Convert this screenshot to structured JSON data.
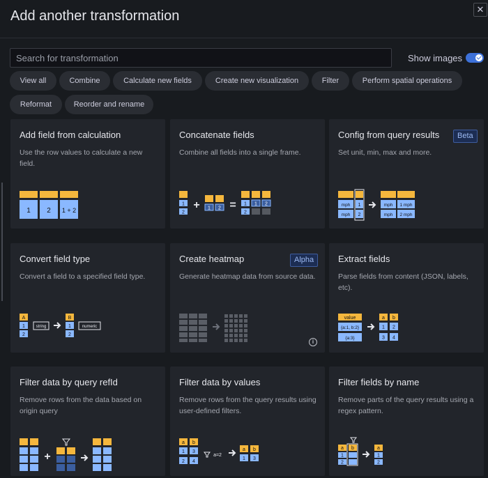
{
  "header": {
    "title": "Add another transformation",
    "close_icon": "close-icon"
  },
  "search": {
    "placeholder": "Search for transformation",
    "value": ""
  },
  "show_images": {
    "label": "Show images",
    "enabled": true
  },
  "filters": [
    "View all",
    "Combine",
    "Calculate new fields",
    "Create new visualization",
    "Filter",
    "Perform spatial operations",
    "Reformat",
    "Reorder and rename"
  ],
  "cards": [
    {
      "title": "Add field from calculation",
      "description": "Use the row values to calculate a new field.",
      "badge": ""
    },
    {
      "title": "Concatenate fields",
      "description": "Combine all fields into a single frame.",
      "badge": ""
    },
    {
      "title": "Config from query results",
      "description": "Set unit, min, max and more.",
      "badge": "Beta"
    },
    {
      "title": "Convert field type",
      "description": "Convert a field to a specified field type.",
      "badge": ""
    },
    {
      "title": "Create heatmap",
      "description": "Generate heatmap data from source data.",
      "badge": "Alpha"
    },
    {
      "title": "Extract fields",
      "description": "Parse fields from content (JSON, labels, etc).",
      "badge": ""
    },
    {
      "title": "Filter data by query refId",
      "description": "Remove rows from the data based on origin query",
      "badge": ""
    },
    {
      "title": "Filter data by values",
      "description": "Remove rows from the query results using user-defined filters.",
      "badge": ""
    },
    {
      "title": "Filter fields by name",
      "description": "Remove parts of the query results using a regex pattern.",
      "badge": ""
    }
  ],
  "illustrations": {
    "add_field": [
      "1",
      "2",
      "1 + 2"
    ],
    "concatenate": [
      "1",
      "2",
      "1",
      "2",
      "1",
      "1",
      "2",
      "2"
    ],
    "config": [
      "mph",
      "1",
      "mph",
      "2",
      "mph",
      "1 mph",
      "mph",
      "2 mph"
    ],
    "convert": [
      "A",
      "1",
      "2",
      "string",
      "B",
      "1",
      "2",
      "numeric"
    ],
    "extract": [
      "value",
      "{a:1, b:2}",
      "{a:3}",
      "a",
      "b",
      "1",
      "2",
      "3",
      "4"
    ],
    "filter_values": [
      "a",
      "b",
      "1",
      "3",
      "2",
      "4",
      "a=2",
      "a",
      "b",
      "1",
      "3"
    ],
    "filter_name": [
      "a",
      "b",
      "1",
      "2",
      "a",
      "1",
      "2"
    ]
  },
  "colors": {
    "accent": "#3d71d9",
    "orange": "#f5b73d",
    "cell_blue": "#8ab8ff",
    "dark_cell": "#3b5e9f"
  }
}
